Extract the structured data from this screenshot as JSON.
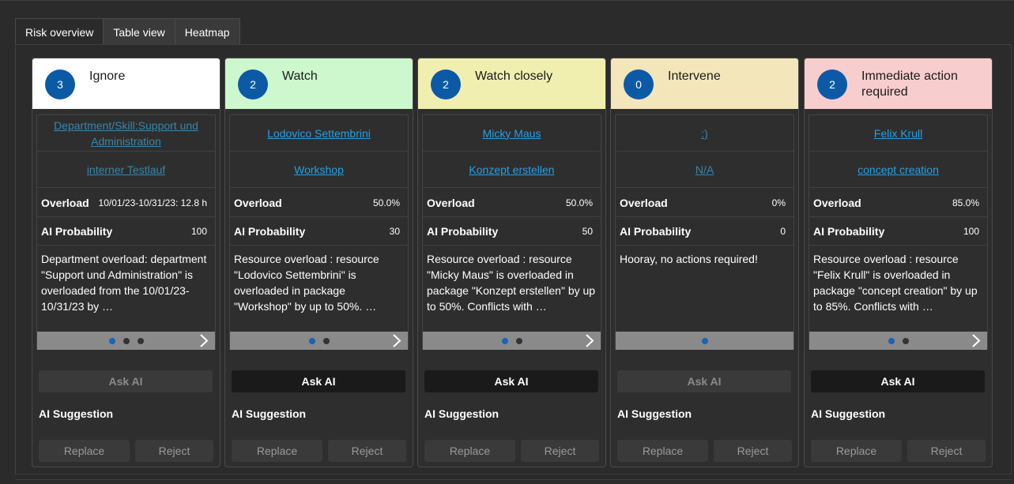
{
  "tabs": [
    "Risk overview",
    "Table view",
    "Heatmap"
  ],
  "colors": {
    "ignore": "#ffffff",
    "watch": "#cdf7cd",
    "watch_closely": "#f1efb0",
    "intervene": "#f3e6bb",
    "immediate": "#f8cdcd",
    "badge": "#0c5aa6",
    "link": "#2a9ee0"
  },
  "labels": {
    "overload": "Overload",
    "ai_probability": "AI Probability",
    "ask_ai": "Ask AI",
    "ai_suggestion": "AI Suggestion",
    "replace": "Replace",
    "reject": "Reject"
  },
  "cards": [
    {
      "count": "3",
      "title": "Ignore",
      "link1": "Department/Skill:Support und Administration",
      "link2": "interner Testlauf",
      "overload": "10/01/23-10/31/23: 12.8 h",
      "probability": "100",
      "description": "Department overload: department \"Support und Administration\" is overloaded from the 10/01/23-10/31/23 by …",
      "dots": 3,
      "active_dot": 0,
      "ask_ai_enabled": false
    },
    {
      "count": "2",
      "title": "Watch",
      "link1": "Lodovico Settembrini",
      "link2": "Workshop",
      "overload": "50.0%",
      "probability": "30",
      "description": "Resource overload : resource \"Lodovico Settembrini\" is overloaded in package \"Workshop\" by up to 50%. …",
      "dots": 2,
      "active_dot": 0,
      "ask_ai_enabled": true
    },
    {
      "count": "2",
      "title": "Watch closely",
      "link1": "Micky Maus",
      "link2": "Konzept erstellen",
      "overload": "50.0%",
      "probability": "50",
      "description": "Resource overload : resource \"Micky Maus\" is overloaded in package \"Konzept erstellen\" by up to 50%. Conflicts with …",
      "dots": 2,
      "active_dot": 0,
      "ask_ai_enabled": true
    },
    {
      "count": "0",
      "title": "Intervene",
      "link1": ":)",
      "link2": "N/A",
      "overload": "0%",
      "probability": "0",
      "description": "Hooray, no actions required!",
      "dots": 1,
      "active_dot": 0,
      "ask_ai_enabled": false
    },
    {
      "count": "2",
      "title": "Immediate action required",
      "link1": "Felix Krull",
      "link2": "concept creation",
      "overload": "85.0%",
      "probability": "100",
      "description": "Resource overload : resource \"Felix Krull\" is overloaded in package \"concept creation\" by up to 85%. Conflicts with …",
      "dots": 2,
      "active_dot": 0,
      "ask_ai_enabled": true
    }
  ]
}
